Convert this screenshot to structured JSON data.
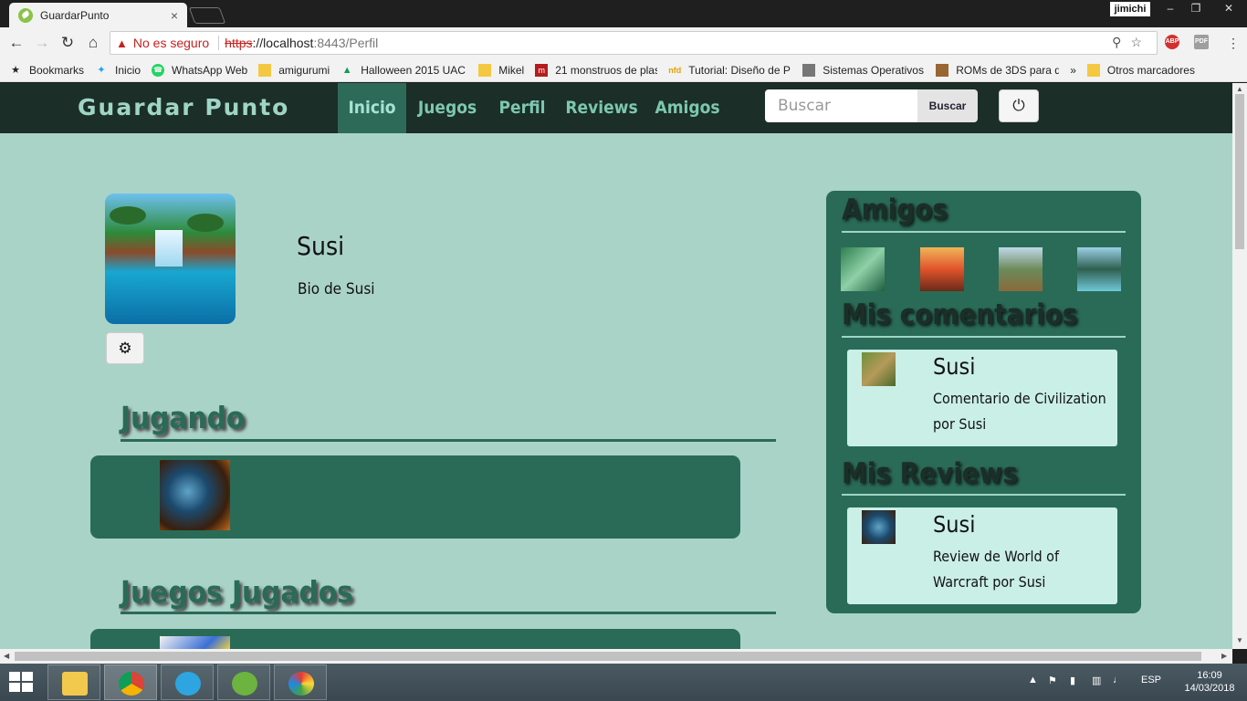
{
  "browser": {
    "tab_title": "GuardarPunto",
    "tab_close": "×",
    "profile": "jimichi",
    "security_label": "No es seguro",
    "url_scheme": "https",
    "url_host": "://localhost",
    "url_rest": ":8443/Perfil",
    "extensions": [
      "ABP",
      "PDF"
    ],
    "bookmarks": [
      {
        "label": "Bookmarks",
        "icon": "star-icon"
      },
      {
        "label": "Inicio",
        "icon": "twitter-icon"
      },
      {
        "label": "WhatsApp Web",
        "icon": "whatsapp-icon"
      },
      {
        "label": "amigurumi",
        "icon": "folder-icon"
      },
      {
        "label": "Halloween 2015 UAC",
        "icon": "drive-icon"
      },
      {
        "label": "Mikel",
        "icon": "folder-icon"
      },
      {
        "label": "21 monstruos de plas",
        "icon": "m-icon"
      },
      {
        "label": "Tutorial: Diseño de P",
        "icon": "nfd-icon"
      },
      {
        "label": "Sistemas Operativos:",
        "icon": "site-icon"
      },
      {
        "label": "ROMs de 3DS para d",
        "icon": "site-icon"
      }
    ],
    "bookmarks_more": "»",
    "other_bookmarks": "Otros marcadores"
  },
  "site": {
    "brand": "Guardar Punto",
    "nav": [
      "Inicio",
      "Juegos",
      "Perfil",
      "Reviews",
      "Amigos"
    ],
    "active_nav": "Inicio",
    "search_placeholder": "Buscar",
    "search_button": "Buscar"
  },
  "profile": {
    "name": "Susi",
    "bio": "Bio de Susi"
  },
  "sections": {
    "playing": "Jugando",
    "played": "Juegos Jugados"
  },
  "sidebar": {
    "friends_title": "Amigos",
    "comments_title": "Mis comentarios",
    "reviews_title": "Mis Reviews",
    "comment": {
      "author": "Susi",
      "text": "Comentario de Civilization por Susi"
    },
    "review": {
      "author": "Susi",
      "text": "Review de World of Warcraft por Susi"
    }
  },
  "taskbar": {
    "language": "ESP",
    "time": "16:09",
    "date": "14/03/2018"
  },
  "colors": {
    "page_bg": "#aad3c8",
    "nav_bg": "#1b2e27",
    "accent": "#2a6b57",
    "card_bg": "#c9efe6"
  }
}
